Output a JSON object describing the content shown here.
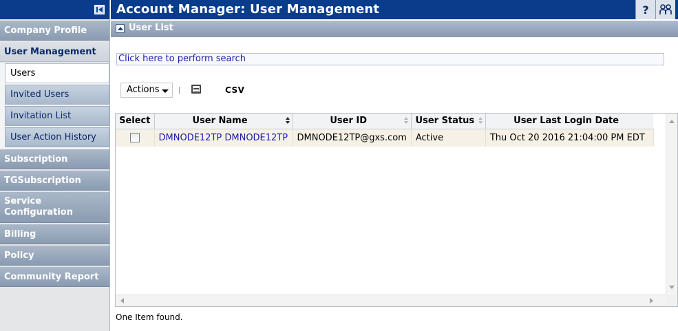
{
  "header": {
    "title": "Account Manager: User Management",
    "help_glyph": "?",
    "icons": [
      "help-icon",
      "users-icon"
    ]
  },
  "sidebar": {
    "items": [
      {
        "label": "Company Profile"
      },
      {
        "label": "User Management",
        "active": true
      },
      {
        "label": "Subscription"
      },
      {
        "label": "TGSubscription"
      },
      {
        "label": "Service Configuration"
      },
      {
        "label": "Billing"
      },
      {
        "label": "Policy"
      },
      {
        "label": "Community Report"
      }
    ],
    "sub_items": [
      {
        "label": "Users",
        "current": true
      },
      {
        "label": "Invited Users"
      },
      {
        "label": "Invitation List"
      },
      {
        "label": "User Action History"
      }
    ]
  },
  "section": {
    "title": "User List"
  },
  "search": {
    "link_text": "Click here to perform search"
  },
  "toolbar": {
    "actions_label": "Actions",
    "csv_label": "CSV"
  },
  "table": {
    "columns": [
      "Select",
      "User Name",
      "User ID",
      "User Status",
      "User Last Login Date"
    ],
    "sorted_column": "User Name",
    "rows": [
      {
        "selected": false,
        "user_name": "DMNODE12TP DMNODE12TP",
        "user_id": "DMNODE12TP@gxs.com",
        "status": "Active",
        "last_login": "Thu Oct 20 2016 21:04:00 PM EDT"
      }
    ]
  },
  "footer": {
    "count_text": "One Item found."
  },
  "colors": {
    "header_bg": "#0a3c8c",
    "link": "#1a1aa6",
    "row_bg": "#f5f1e6"
  }
}
